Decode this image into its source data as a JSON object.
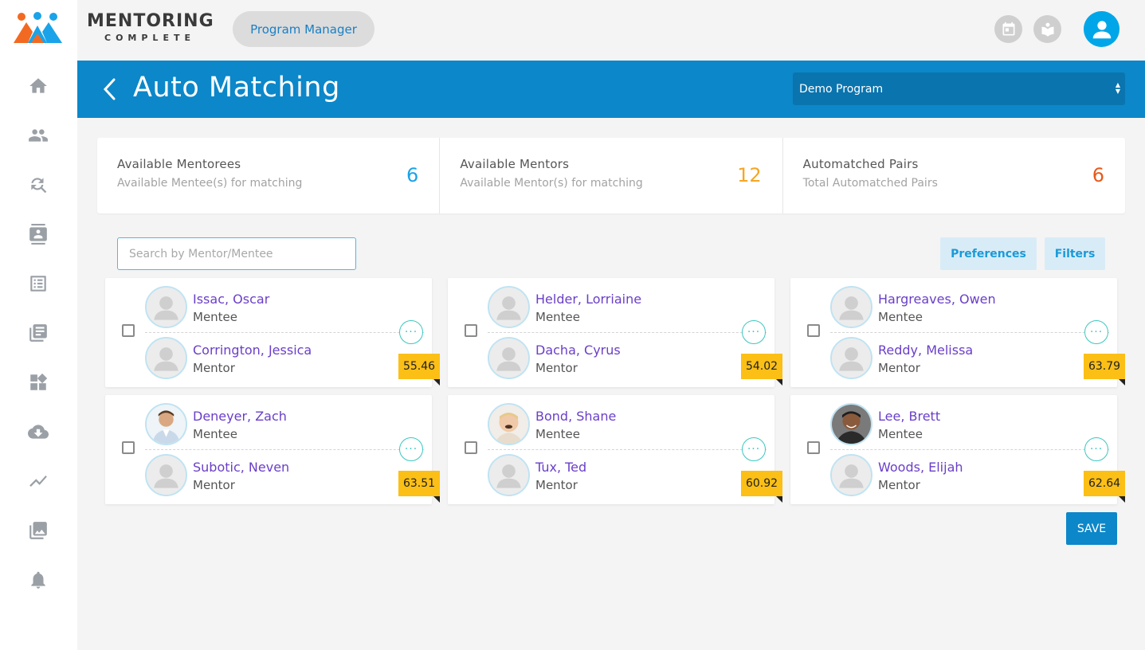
{
  "header": {
    "brand_main": "MENTORING",
    "brand_sub": "COMPLETE",
    "role": "Program Manager"
  },
  "titlebar": {
    "title": "Auto Matching",
    "program": "Demo Program"
  },
  "stats": [
    {
      "title": "Available Mentorees",
      "subtitle": "Available Mentee(s) for matching",
      "value": "6",
      "color": "#1aa3e8"
    },
    {
      "title": "Available Mentors",
      "subtitle": "Available Mentor(s) for matching",
      "value": "12",
      "color": "#f5a623"
    },
    {
      "title": "Automatched Pairs",
      "subtitle": "Total Automatched Pairs",
      "value": "6",
      "color": "#e8591a"
    }
  ],
  "search": {
    "placeholder": "Search by Mentor/Mentee"
  },
  "buttons": {
    "preferences": "Preferences",
    "filters": "Filters",
    "save": "SAVE"
  },
  "pairs": [
    {
      "mentee": "Issac, Oscar",
      "mentee_role": "Mentee",
      "mentor": "Corrington, Jessica",
      "mentor_role": "Mentor",
      "score": "55.46"
    },
    {
      "mentee": "Helder, Lorriaine",
      "mentee_role": "Mentee",
      "mentor": "Dacha, Cyrus",
      "mentor_role": "Mentor",
      "score": "54.02"
    },
    {
      "mentee": "Hargreaves, Owen",
      "mentee_role": "Mentee",
      "mentor": "Reddy, Melissa",
      "mentor_role": "Mentor",
      "score": "63.79"
    },
    {
      "mentee": "Deneyer, Zach",
      "mentee_role": "Mentee",
      "mentor": "Subotic, Neven",
      "mentor_role": "Mentor",
      "score": "63.51"
    },
    {
      "mentee": "Bond, Shane",
      "mentee_role": "Mentee",
      "mentor": "Tux, Ted",
      "mentor_role": "Mentor",
      "score": "60.92"
    },
    {
      "mentee": "Lee, Brett",
      "mentee_role": "Mentee",
      "mentor": "Woods, Elijah",
      "mentor_role": "Mentor",
      "score": "62.64"
    }
  ],
  "more_glyph": "···"
}
